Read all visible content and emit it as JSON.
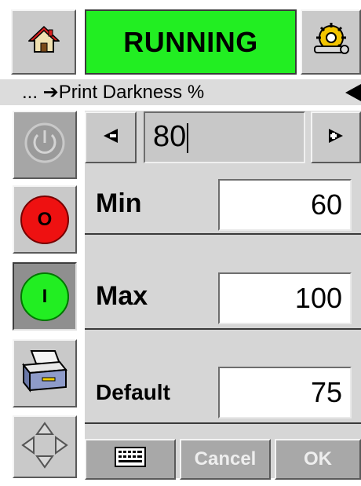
{
  "header": {
    "status_text": "RUNNING",
    "status_color": "#22ee22",
    "home_icon": "home-icon",
    "settings_icon": "settings-gear-wrench-icon"
  },
  "breadcrumb": {
    "text": "... ➔Print Darkness %",
    "back_icon": "left-arrow-icon"
  },
  "sidebar": {
    "power_icon": "power-icon",
    "stop_label": "O",
    "start_label": "I",
    "printer_icon": "printer-icon",
    "nav_icon": "navigation-arrows-icon"
  },
  "field": {
    "value": "80",
    "decrement_icon": "left-triangle-icon",
    "increment_icon": "right-triangle-icon",
    "min_label": "Min",
    "min_value": "60",
    "max_label": "Max",
    "max_value": "100",
    "default_label": "Default",
    "default_value": "75"
  },
  "footer": {
    "keyboard_icon": "keyboard-icon",
    "cancel_label": "Cancel",
    "ok_label": "OK"
  }
}
